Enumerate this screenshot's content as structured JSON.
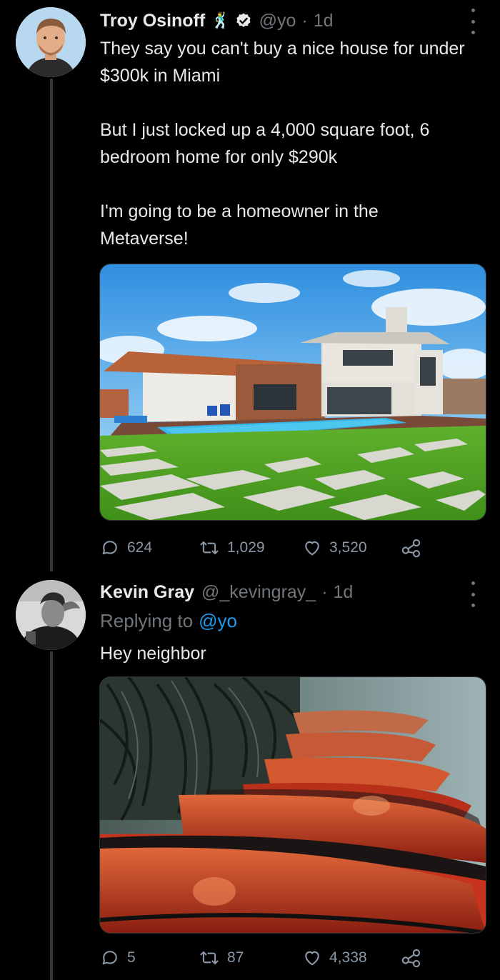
{
  "tweet1": {
    "name": "Troy Osinoff",
    "emoji": "🕺",
    "handle": "@yo",
    "dot": "·",
    "time": "1d",
    "text_lines": [
      "They say you can't buy a nice house for under $300k in Miami",
      "But I just locked up a 4,000 square foot, 6 bedroom home for only $290k",
      "I'm going to be a homeowner in the Metaverse!"
    ],
    "replies": "624",
    "retweets": "1,029",
    "likes": "3,520"
  },
  "tweet2": {
    "name": "Kevin Gray",
    "handle": "@_kevingray_",
    "dot": "·",
    "time": "1d",
    "replying_prefix": "Replying to",
    "replying_handle": "@yo",
    "text": "Hey neighbor",
    "replies": "5",
    "retweets": "87",
    "likes": "4,338"
  },
  "colors": {
    "background": "#000000",
    "text": "#e7e9ea",
    "muted": "#71767b",
    "accent": "#1d9bf0",
    "thread_line": "#333639"
  },
  "icons": [
    "more-icon",
    "verified-icon",
    "reply-icon",
    "retweet-icon",
    "like-icon",
    "share-icon"
  ]
}
